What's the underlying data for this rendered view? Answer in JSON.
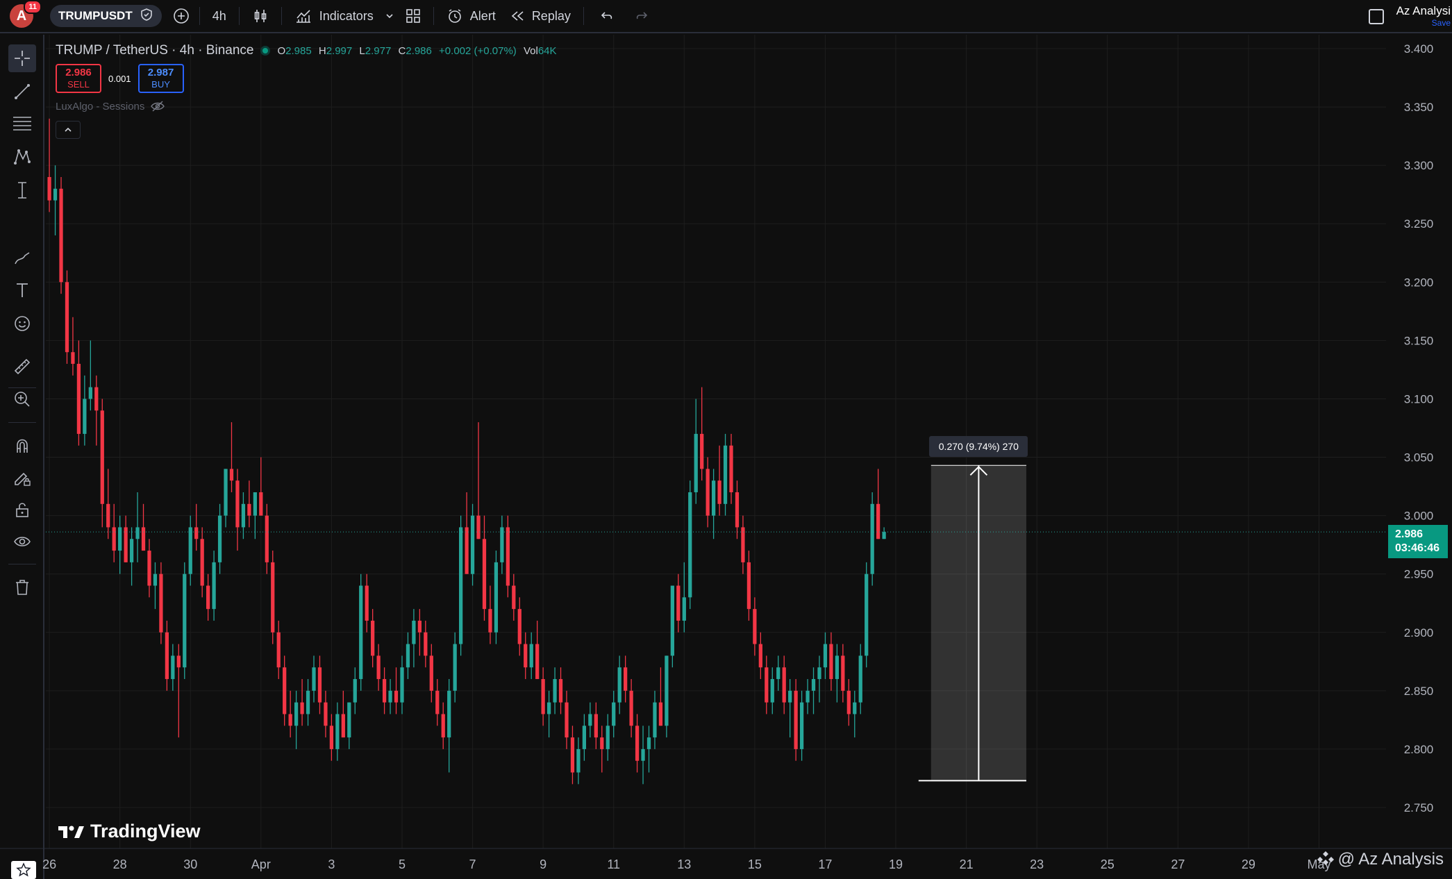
{
  "topbar": {
    "avatar_letter": "A",
    "notification_count": "11",
    "symbol": "TRUMPUSDT",
    "interval": "4h",
    "indicators_label": "Indicators",
    "alert_label": "Alert",
    "replay_label": "Replay",
    "user_name": "Az Analysi",
    "save_label": "Save"
  },
  "legend": {
    "title": "TRUMP / TetherUS · 4h · Binance",
    "o_label": "O",
    "o_value": "2.985",
    "h_label": "H",
    "h_value": "2.997",
    "l_label": "L",
    "l_value": "2.977",
    "c_label": "C",
    "c_value": "2.986",
    "change": "+0.002 (+0.07%)",
    "vol_label": "Vol",
    "vol_value": "64K"
  },
  "trade": {
    "sell_price": "2.986",
    "sell_label": "SELL",
    "spread": "0.001",
    "buy_price": "2.987",
    "buy_label": "BUY"
  },
  "indicator_name": "LuxAlgo - Sessions",
  "watermark": "TradingView",
  "credit": "@ Az Analysis",
  "price_tag": {
    "price": "2.986",
    "countdown": "03:46:46"
  },
  "measure_label": "0.270 (9.74%) 270",
  "colors": {
    "up": "#26a69a",
    "down": "#f23645",
    "background": "#0f0f0f",
    "grid": "#1e1e1e"
  },
  "left_tools": [
    "crosshair-icon",
    "trendline-icon",
    "fib-icon",
    "pattern-icon",
    "measure-icon",
    "brush-icon",
    "text-icon",
    "emoji-icon",
    "ruler-icon",
    "zoom-in-icon",
    "magnet-icon",
    "lock-draw-icon",
    "lock-icon",
    "eye-icon",
    "trash-icon",
    "favorites-icon"
  ],
  "chart_data": {
    "type": "candlestick",
    "title": "TRUMP / TetherUS · 4h · Binance",
    "y_ticks": [
      "3.400",
      "3.350",
      "3.300",
      "3.250",
      "3.200",
      "3.150",
      "3.100",
      "3.050",
      "3.000",
      "2.950",
      "2.900",
      "2.850",
      "2.800",
      "2.750"
    ],
    "ylim": [
      2.735,
      3.41
    ],
    "x_ticks": [
      "26",
      "28",
      "30",
      "Apr",
      "3",
      "5",
      "7",
      "9",
      "11",
      "13",
      "15",
      "17",
      "19",
      "21",
      "23",
      "25",
      "27",
      "29",
      "May"
    ],
    "x_tick_days": [
      0,
      2,
      4,
      6,
      8,
      10,
      12,
      14,
      16,
      18,
      20,
      22,
      24,
      26,
      28,
      30,
      32,
      34,
      36
    ],
    "xlim_days": [
      -0.1,
      37.9
    ],
    "candles_per_day": 6,
    "last_price": 2.986,
    "measure": {
      "from": 2.773,
      "to": 3.043,
      "start_day": 25.0,
      "end_day": 27.7
    },
    "candles": [
      [
        3.29,
        3.34,
        3.26,
        3.27
      ],
      [
        3.27,
        3.3,
        3.24,
        3.28
      ],
      [
        3.28,
        3.29,
        3.19,
        3.2
      ],
      [
        3.2,
        3.21,
        3.13,
        3.14
      ],
      [
        3.14,
        3.17,
        3.12,
        3.13
      ],
      [
        3.13,
        3.15,
        3.06,
        3.07
      ],
      [
        3.07,
        3.12,
        3.06,
        3.1
      ],
      [
        3.1,
        3.15,
        3.09,
        3.11
      ],
      [
        3.11,
        3.12,
        3.06,
        3.09
      ],
      [
        3.09,
        3.1,
        2.99,
        3.01
      ],
      [
        3.01,
        3.04,
        2.98,
        2.99
      ],
      [
        2.99,
        3.01,
        2.96,
        2.97
      ],
      [
        2.97,
        3.0,
        2.95,
        2.99
      ],
      [
        2.99,
        3.0,
        2.96,
        2.96
      ],
      [
        2.96,
        2.99,
        2.94,
        2.98
      ],
      [
        2.98,
        3.02,
        2.96,
        2.99
      ],
      [
        2.99,
        3.01,
        2.97,
        2.97
      ],
      [
        2.97,
        2.98,
        2.93,
        2.94
      ],
      [
        2.94,
        2.96,
        2.92,
        2.95
      ],
      [
        2.95,
        2.96,
        2.89,
        2.9
      ],
      [
        2.9,
        2.91,
        2.85,
        2.86
      ],
      [
        2.86,
        2.89,
        2.85,
        2.88
      ],
      [
        2.88,
        2.89,
        2.81,
        2.87
      ],
      [
        2.87,
        2.96,
        2.86,
        2.95
      ],
      [
        2.95,
        3.0,
        2.94,
        2.99
      ],
      [
        2.99,
        3.01,
        2.97,
        2.98
      ],
      [
        2.98,
        2.99,
        2.93,
        2.94
      ],
      [
        2.94,
        2.95,
        2.91,
        2.92
      ],
      [
        2.92,
        2.97,
        2.91,
        2.96
      ],
      [
        2.96,
        3.01,
        2.95,
        3.0
      ],
      [
        3.0,
        3.04,
        2.99,
        3.04
      ],
      [
        3.04,
        3.08,
        3.02,
        3.03
      ],
      [
        3.03,
        3.04,
        2.97,
        2.99
      ],
      [
        2.99,
        3.02,
        2.98,
        3.01
      ],
      [
        3.01,
        3.03,
        2.99,
        3.0
      ],
      [
        3.0,
        3.02,
        2.98,
        3.02
      ],
      [
        3.02,
        3.05,
        3.0,
        3.0
      ],
      [
        3.0,
        3.01,
        2.95,
        2.96
      ],
      [
        2.96,
        2.97,
        2.89,
        2.9
      ],
      [
        2.9,
        2.91,
        2.86,
        2.87
      ],
      [
        2.87,
        2.88,
        2.82,
        2.83
      ],
      [
        2.83,
        2.85,
        2.81,
        2.82
      ],
      [
        2.82,
        2.85,
        2.8,
        2.84
      ],
      [
        2.84,
        2.86,
        2.82,
        2.83
      ],
      [
        2.83,
        2.86,
        2.82,
        2.85
      ],
      [
        2.85,
        2.88,
        2.84,
        2.87
      ],
      [
        2.87,
        2.88,
        2.83,
        2.84
      ],
      [
        2.84,
        2.85,
        2.81,
        2.82
      ],
      [
        2.82,
        2.83,
        2.79,
        2.8
      ],
      [
        2.8,
        2.84,
        2.79,
        2.83
      ],
      [
        2.83,
        2.85,
        2.81,
        2.81
      ],
      [
        2.81,
        2.84,
        2.8,
        2.84
      ],
      [
        2.84,
        2.87,
        2.83,
        2.86
      ],
      [
        2.86,
        2.95,
        2.85,
        2.94
      ],
      [
        2.94,
        2.95,
        2.9,
        2.91
      ],
      [
        2.91,
        2.92,
        2.87,
        2.88
      ],
      [
        2.88,
        2.89,
        2.85,
        2.86
      ],
      [
        2.86,
        2.87,
        2.83,
        2.84
      ],
      [
        2.84,
        2.86,
        2.83,
        2.85
      ],
      [
        2.85,
        2.87,
        2.83,
        2.84
      ],
      [
        2.84,
        2.88,
        2.83,
        2.87
      ],
      [
        2.87,
        2.9,
        2.86,
        2.89
      ],
      [
        2.89,
        2.92,
        2.87,
        2.91
      ],
      [
        2.91,
        2.92,
        2.88,
        2.9
      ],
      [
        2.9,
        2.91,
        2.87,
        2.88
      ],
      [
        2.88,
        2.89,
        2.84,
        2.85
      ],
      [
        2.85,
        2.86,
        2.82,
        2.83
      ],
      [
        2.83,
        2.84,
        2.8,
        2.81
      ],
      [
        2.81,
        2.86,
        2.78,
        2.85
      ],
      [
        2.85,
        2.9,
        2.84,
        2.89
      ],
      [
        2.89,
        3.0,
        2.88,
        2.99
      ],
      [
        2.99,
        3.02,
        2.95,
        2.95
      ],
      [
        2.95,
        3.01,
        2.94,
        3.0
      ],
      [
        3.0,
        3.08,
        2.98,
        2.98
      ],
      [
        2.98,
        3.0,
        2.91,
        2.92
      ],
      [
        2.92,
        2.94,
        2.89,
        2.9
      ],
      [
        2.9,
        2.97,
        2.89,
        2.96
      ],
      [
        2.96,
        3.0,
        2.95,
        2.99
      ],
      [
        2.99,
        3.0,
        2.93,
        2.94
      ],
      [
        2.94,
        2.95,
        2.91,
        2.92
      ],
      [
        2.92,
        2.93,
        2.88,
        2.89
      ],
      [
        2.89,
        2.9,
        2.86,
        2.87
      ],
      [
        2.87,
        2.9,
        2.86,
        2.89
      ],
      [
        2.89,
        2.91,
        2.86,
        2.86
      ],
      [
        2.86,
        2.87,
        2.82,
        2.83
      ],
      [
        2.83,
        2.85,
        2.81,
        2.84
      ],
      [
        2.84,
        2.87,
        2.83,
        2.86
      ],
      [
        2.86,
        2.87,
        2.83,
        2.84
      ],
      [
        2.84,
        2.85,
        2.8,
        2.81
      ],
      [
        2.81,
        2.82,
        2.77,
        2.78
      ],
      [
        2.78,
        2.81,
        2.77,
        2.8
      ],
      [
        2.8,
        2.83,
        2.79,
        2.82
      ],
      [
        2.82,
        2.84,
        2.81,
        2.83
      ],
      [
        2.83,
        2.84,
        2.8,
        2.81
      ],
      [
        2.81,
        2.82,
        2.78,
        2.8
      ],
      [
        2.8,
        2.83,
        2.79,
        2.82
      ],
      [
        2.82,
        2.85,
        2.81,
        2.84
      ],
      [
        2.84,
        2.88,
        2.83,
        2.87
      ],
      [
        2.87,
        2.88,
        2.84,
        2.85
      ],
      [
        2.85,
        2.86,
        2.81,
        2.82
      ],
      [
        2.82,
        2.83,
        2.78,
        2.79
      ],
      [
        2.79,
        2.82,
        2.77,
        2.8
      ],
      [
        2.8,
        2.82,
        2.78,
        2.81
      ],
      [
        2.81,
        2.85,
        2.8,
        2.84
      ],
      [
        2.84,
        2.87,
        2.82,
        2.82
      ],
      [
        2.82,
        2.88,
        2.81,
        2.88
      ],
      [
        2.88,
        2.94,
        2.87,
        2.94
      ],
      [
        2.94,
        2.95,
        2.9,
        2.91
      ],
      [
        2.91,
        2.96,
        2.9,
        2.93
      ],
      [
        2.93,
        3.03,
        2.92,
        3.02
      ],
      [
        3.02,
        3.1,
        3.01,
        3.07
      ],
      [
        3.07,
        3.11,
        3.03,
        3.04
      ],
      [
        3.04,
        3.05,
        2.99,
        3.0
      ],
      [
        3.0,
        3.04,
        2.98,
        3.03
      ],
      [
        3.03,
        3.06,
        3.0,
        3.01
      ],
      [
        3.01,
        3.07,
        3.0,
        3.06
      ],
      [
        3.06,
        3.07,
        3.01,
        3.02
      ],
      [
        3.02,
        3.03,
        2.98,
        2.99
      ],
      [
        2.99,
        3.0,
        2.95,
        2.96
      ],
      [
        2.96,
        2.97,
        2.91,
        2.92
      ],
      [
        2.92,
        2.93,
        2.88,
        2.89
      ],
      [
        2.89,
        2.9,
        2.86,
        2.87
      ],
      [
        2.87,
        2.88,
        2.83,
        2.84
      ],
      [
        2.84,
        2.87,
        2.83,
        2.86
      ],
      [
        2.86,
        2.88,
        2.85,
        2.87
      ],
      [
        2.87,
        2.88,
        2.83,
        2.84
      ],
      [
        2.84,
        2.86,
        2.81,
        2.85
      ],
      [
        2.85,
        2.86,
        2.79,
        2.8
      ],
      [
        2.8,
        2.85,
        2.79,
        2.84
      ],
      [
        2.84,
        2.86,
        2.83,
        2.85
      ],
      [
        2.85,
        2.87,
        2.83,
        2.86
      ],
      [
        2.86,
        2.88,
        2.84,
        2.87
      ],
      [
        2.87,
        2.9,
        2.86,
        2.89
      ],
      [
        2.89,
        2.9,
        2.85,
        2.86
      ],
      [
        2.86,
        2.89,
        2.84,
        2.88
      ],
      [
        2.88,
        2.89,
        2.84,
        2.85
      ],
      [
        2.85,
        2.86,
        2.82,
        2.83
      ],
      [
        2.83,
        2.85,
        2.81,
        2.84
      ],
      [
        2.84,
        2.89,
        2.83,
        2.88
      ],
      [
        2.88,
        2.96,
        2.87,
        2.95
      ],
      [
        2.95,
        3.02,
        2.94,
        3.01
      ],
      [
        3.01,
        3.04,
        2.98,
        2.98
      ],
      [
        2.98,
        2.99,
        2.98,
        2.986
      ]
    ]
  }
}
